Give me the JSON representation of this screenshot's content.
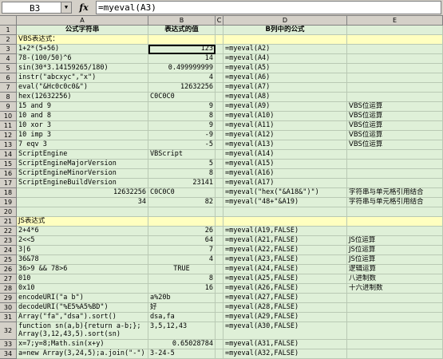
{
  "formula_bar": {
    "cell_ref": "B3",
    "fx": "fx",
    "formula": "=myeval(A3)"
  },
  "columns": [
    "A",
    "B",
    "C",
    "D",
    "E"
  ],
  "headers": {
    "a": "公式字符串",
    "b": "表达式的值",
    "d": "B列中的公式"
  },
  "rows": [
    {
      "n": "1",
      "a": "公式字符串",
      "b": "表达式的值",
      "d": "B列中的公式",
      "e": "",
      "kind": "header"
    },
    {
      "n": "2",
      "a": "VBS表达式：",
      "b": "",
      "d": "",
      "e": "",
      "kind": "section"
    },
    {
      "n": "3",
      "a": "1+2*(5+56)",
      "b": "123",
      "d": "=myeval(A2)",
      "e": ""
    },
    {
      "n": "4",
      "a": "78-(100/50)^6",
      "b": "14",
      "d": "=myeval(A4)",
      "e": ""
    },
    {
      "n": "5",
      "a": "sin(30*3.14159265/180)",
      "b": "0.499999999",
      "d": "=myeval(A5)",
      "e": ""
    },
    {
      "n": "6",
      "a": "instr(\"abcxyc\",\"x\")",
      "b": "4",
      "d": "=myeval(A6)",
      "e": ""
    },
    {
      "n": "7",
      "a": "eval(\"&Hc0c0c0&\")",
      "b": "12632256",
      "d": "=myeval(A7)",
      "e": ""
    },
    {
      "n": "8",
      "a": "hex(12632256)",
      "b": "C0C0C0",
      "d": "=myeval(A8)",
      "e": "",
      "bl": true
    },
    {
      "n": "9",
      "a": "15 and 9",
      "b": "9",
      "d": "=myeval(A9)",
      "e": "VBS位运算"
    },
    {
      "n": "10",
      "a": "10 and 8",
      "b": "8",
      "d": "=myeval(A10)",
      "e": "VBS位运算"
    },
    {
      "n": "11",
      "a": "10 xor 3",
      "b": "9",
      "d": "=myeval(A11)",
      "e": "VBS位运算"
    },
    {
      "n": "12",
      "a": "10 imp 3",
      "b": "-9",
      "d": "=myeval(A12)",
      "e": "VBS位运算"
    },
    {
      "n": "13",
      "a": "7 eqv 3",
      "b": "-5",
      "d": "=myeval(A13)",
      "e": "VBS位运算"
    },
    {
      "n": "14",
      "a": "ScriptEngine",
      "b": "VBScript",
      "d": "=myeval(A14)",
      "e": "",
      "bl": true
    },
    {
      "n": "15",
      "a": "ScriptEngineMajorVersion",
      "b": "5",
      "d": "=myeval(A15)",
      "e": ""
    },
    {
      "n": "16",
      "a": "ScriptEngineMinorVersion",
      "b": "8",
      "d": "=myeval(A16)",
      "e": ""
    },
    {
      "n": "17",
      "a": "ScriptEngineBuildVersion",
      "b": "23141",
      "d": "=myeval(A17)",
      "e": ""
    },
    {
      "n": "18",
      "a": "12632256",
      "b": "C0C0C0",
      "d": "=myeval(\"hex(\"&A18&\")\")",
      "e": "字符串与单元格引用结合",
      "ar": true,
      "bl": true
    },
    {
      "n": "19",
      "a": "34",
      "b": "82",
      "d": "=myeval(\"48+\"&A19)",
      "e": "字符串与单元格引用结合",
      "ar": true
    },
    {
      "n": "20",
      "a": "",
      "b": "",
      "d": "",
      "e": ""
    },
    {
      "n": "21",
      "a": "JS表达式",
      "b": "",
      "d": "",
      "e": "",
      "kind": "section"
    },
    {
      "n": "22",
      "a": "2+4*6",
      "b": "26",
      "d": "=myeval(A19,FALSE)",
      "e": ""
    },
    {
      "n": "23",
      "a": "2<<5",
      "b": "64",
      "d": "=myeval(A21,FALSE)",
      "e": "JS位运算"
    },
    {
      "n": "24",
      "a": "3|6",
      "b": "7",
      "d": "=myeval(A22,FALSE)",
      "e": "JS位运算"
    },
    {
      "n": "25",
      "a": "36&78",
      "b": "4",
      "d": "=myeval(A23,FALSE)",
      "e": "JS位运算"
    },
    {
      "n": "26",
      "a": "36>9 && 78>6",
      "b": "TRUE",
      "d": "=myeval(A24,FALSE)",
      "e": "逻辑运算",
      "bc": true
    },
    {
      "n": "27",
      "a": "010",
      "b": "8",
      "d": "=myeval(A25,FALSE)",
      "e": "八进制数"
    },
    {
      "n": "28",
      "a": "0x10",
      "b": "16",
      "d": "=myeval(A26,FALSE)",
      "e": "十六进制数"
    },
    {
      "n": "29",
      "a": "encodeURI(\"a b\")",
      "b": "a%20b",
      "d": "=myeval(A27,FALSE)",
      "e": "",
      "bl": true
    },
    {
      "n": "30",
      "a": "decodeURI(\"%E5%A5%BD\")",
      "b": "好",
      "d": "=myeval(A28,FALSE)",
      "e": "",
      "bl": true
    },
    {
      "n": "31",
      "a": "Array(\"fa\",\"dsa\").sort()",
      "b": "dsa,fa",
      "d": "=myeval(A29,FALSE)",
      "e": "",
      "bl": true
    },
    {
      "n": "32",
      "a": "function sn(a,b){return a-b;};\nArray(3,12,43,5).sort(sn)",
      "b": "3,5,12,43",
      "d": "=myeval(A30,FALSE)",
      "e": "",
      "bl": true,
      "tall": true
    },
    {
      "n": "33",
      "a": "x=7;y=8;Math.sin(x+y)",
      "b": "0.65028784",
      "d": "=myeval(A31,FALSE)",
      "e": ""
    },
    {
      "n": "34",
      "a": "a=new Array(3,24,5);a.join(\"-\")",
      "b": "3-24-5",
      "d": "=myeval(A32,FALSE)",
      "e": "",
      "bl": true
    },
    {
      "n": "",
      "a": "",
      "b": "<A",
      "d": "",
      "e": "",
      "bl": true
    }
  ]
}
